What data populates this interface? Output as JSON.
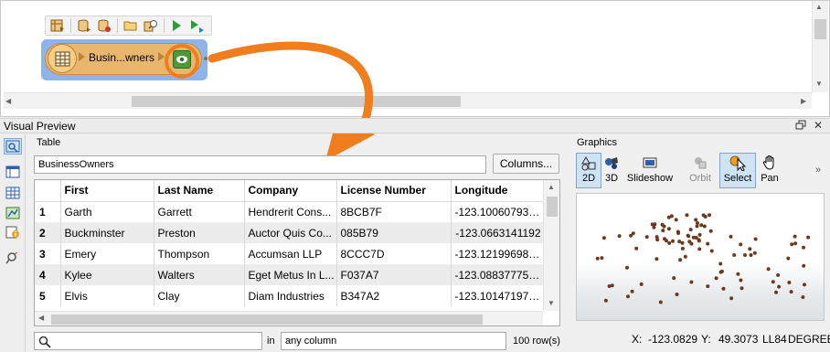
{
  "canvas": {
    "reader": {
      "label": "Busin...wners"
    },
    "toolbar": {
      "icons": [
        "reader-icon",
        "add-reader-icon",
        "add-writer-icon",
        "open-folder-icon",
        "search-icon",
        "run-icon",
        "run-step-icon"
      ]
    }
  },
  "visual_preview": {
    "title": "Visual Preview",
    "float_icon": "restore-window-icon",
    "close": "✕",
    "side_toolbar": {
      "icons": [
        "inspector-icon",
        "table-view-icon",
        "grid-view-icon",
        "graphics-view-icon",
        "info-icon",
        "filter-icon"
      ]
    },
    "table": {
      "label": "Table",
      "selected": "BusinessOwners",
      "columns_button": "Columns...",
      "headers": [
        "First",
        "Last Name",
        "Company",
        "License Number",
        "Longitude"
      ],
      "rows": [
        {
          "n": "1",
          "first": "Garth",
          "last": "Garrett",
          "company": "Hendrerit Cons...",
          "license": "8BCB7F",
          "lon": "-123.1006079306"
        },
        {
          "n": "2",
          "first": "Buckminster",
          "last": "Preston",
          "company": "Auctor Quis Co...",
          "license": "085B79",
          "lon": "-123.0663141192"
        },
        {
          "n": "3",
          "first": "Emery",
          "last": "Thompson",
          "company": "Accumsan LLP",
          "license": "8CCC7D",
          "lon": "-123.1219969846"
        },
        {
          "n": "4",
          "first": "Kylee",
          "last": "Walters",
          "company": "Eget Metus In L...",
          "license": "F037A7",
          "lon": "-123.0883777553"
        },
        {
          "n": "5",
          "first": "Elvis",
          "last": "Clay",
          "company": "Diam Industries",
          "license": "B347A2",
          "lon": "-123.1014719755"
        }
      ],
      "search_placeholder": "",
      "in_label": "in",
      "column_filter": "any column",
      "row_count": "100 row(s)"
    },
    "graphics": {
      "label": "Graphics",
      "buttons": {
        "d2": "2D",
        "d3": "3D",
        "slideshow": "Slideshow",
        "orbit": "Orbit",
        "select": "Select",
        "pan": "Pan"
      },
      "more": "»",
      "point_color": "#6b3a1e",
      "coords": {
        "x_label": "X:",
        "x": "-123.0829",
        "y_label": "Y:",
        "y": "49.3073",
        "system": "LL84",
        "units": "DEGREE"
      }
    }
  },
  "colors": {
    "highlight": "#f07d1e",
    "selection": "#8fb4ec",
    "reader": "#e8b76d"
  }
}
